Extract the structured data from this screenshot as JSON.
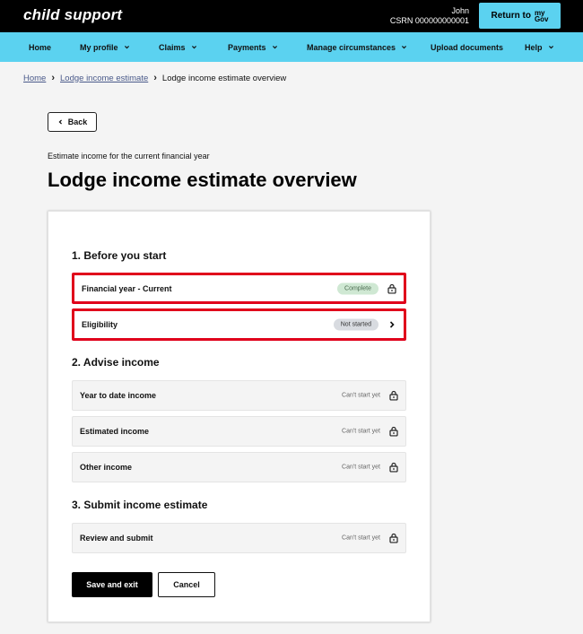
{
  "header": {
    "logo": "child support",
    "user_name": "John",
    "user_csrn": "CSRN 000000000001",
    "return_label": "Return to",
    "mygov_line1": "my",
    "mygov_line2": "Gov"
  },
  "nav": {
    "items": [
      {
        "label": "Home"
      },
      {
        "label": "My profile"
      },
      {
        "label": "Claims"
      },
      {
        "label": "Payments"
      },
      {
        "label": "Manage circumstances"
      },
      {
        "label": "Upload documents"
      },
      {
        "label": "Help"
      }
    ]
  },
  "breadcrumb": {
    "home": "Home",
    "lodge": "Lodge income estimate",
    "current": "Lodge income estimate overview"
  },
  "back_label": "Back",
  "eyebrow": "Estimate income for the current financial year",
  "title": "Lodge income estimate overview",
  "sections": [
    {
      "title": "1. Before you start",
      "tasks": [
        {
          "label": "Financial year - Current",
          "status": "Complete",
          "icon": "lock-icon"
        },
        {
          "label": "Eligibility",
          "status": "Not started",
          "icon": "chevron-right-icon"
        }
      ]
    },
    {
      "title": "2. Advise income",
      "tasks": [
        {
          "label": "Year to date income",
          "status": "Can't start yet",
          "icon": "lock-icon"
        },
        {
          "label": "Estimated income",
          "status": "Can't start yet",
          "icon": "lock-icon"
        },
        {
          "label": "Other income",
          "status": "Can't start yet",
          "icon": "lock-icon"
        }
      ]
    },
    {
      "title": "3. Submit income estimate",
      "tasks": [
        {
          "label": "Review and submit",
          "status": "Can't start yet",
          "icon": "lock-icon"
        }
      ]
    }
  ],
  "actions": {
    "save": "Save and exit",
    "cancel": "Cancel"
  },
  "colors": {
    "header_bg": "#000000",
    "nav_bg": "#5bd2f0",
    "highlight": "#e0001b",
    "complete_bg": "#cfe8d3"
  }
}
